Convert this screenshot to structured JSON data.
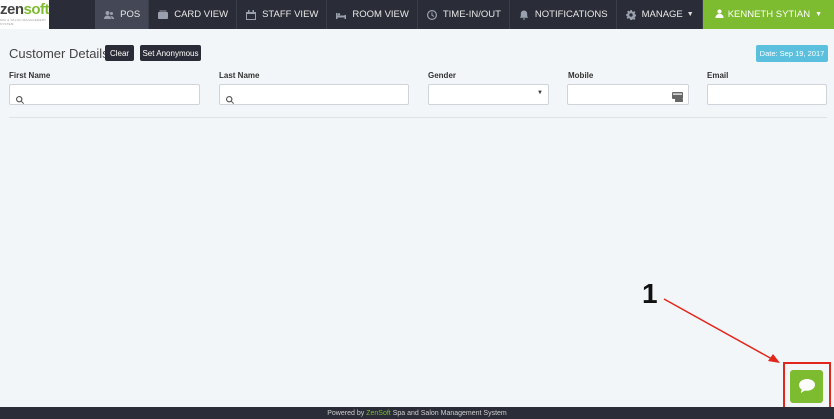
{
  "brand": {
    "name_part1": "zen",
    "name_part2": "soft",
    "tagline": "SPA & SALON MANAGEMENT SYSTEM"
  },
  "nav": {
    "items": [
      {
        "label": "POS",
        "icon": "users-icon",
        "active": true
      },
      {
        "label": "CARD VIEW",
        "icon": "card-icon",
        "active": false
      },
      {
        "label": "STAFF VIEW",
        "icon": "calendar-icon",
        "active": false
      },
      {
        "label": "ROOM VIEW",
        "icon": "bed-icon",
        "active": false
      },
      {
        "label": "TIME-IN/OUT",
        "icon": "clock-icon",
        "active": false
      },
      {
        "label": "NOTIFICATIONS",
        "icon": "bell-icon",
        "active": false
      },
      {
        "label": "MANAGE",
        "icon": "gear-icon",
        "active": false
      }
    ],
    "user": {
      "label": "KENNETH SYTIAN",
      "icon": "user-icon"
    }
  },
  "customer": {
    "title": "Customer Details",
    "clear_label": "Clear",
    "anonymous_label": "Set Anonymous",
    "date_label": "Date: Sep 19, 2017",
    "fields": {
      "first_name": {
        "label": "First Name",
        "value": ""
      },
      "last_name": {
        "label": "Last Name",
        "value": ""
      },
      "gender": {
        "label": "Gender",
        "value": ""
      },
      "mobile": {
        "label": "Mobile",
        "value": ""
      },
      "email": {
        "label": "Email",
        "value": ""
      }
    }
  },
  "annotation": {
    "number": "1"
  },
  "chat": {
    "icon": "chat-icon"
  },
  "footer": {
    "prefix": "Powered by",
    "brand": "ZenSoft",
    "suffix": "Spa and Salon Management System"
  },
  "colors": {
    "navbar": "#2a2d37",
    "accent_green": "#7dbb30",
    "date_badge": "#5bc0de",
    "annotation_red": "#e1261c",
    "background": "#f3f6f8"
  }
}
